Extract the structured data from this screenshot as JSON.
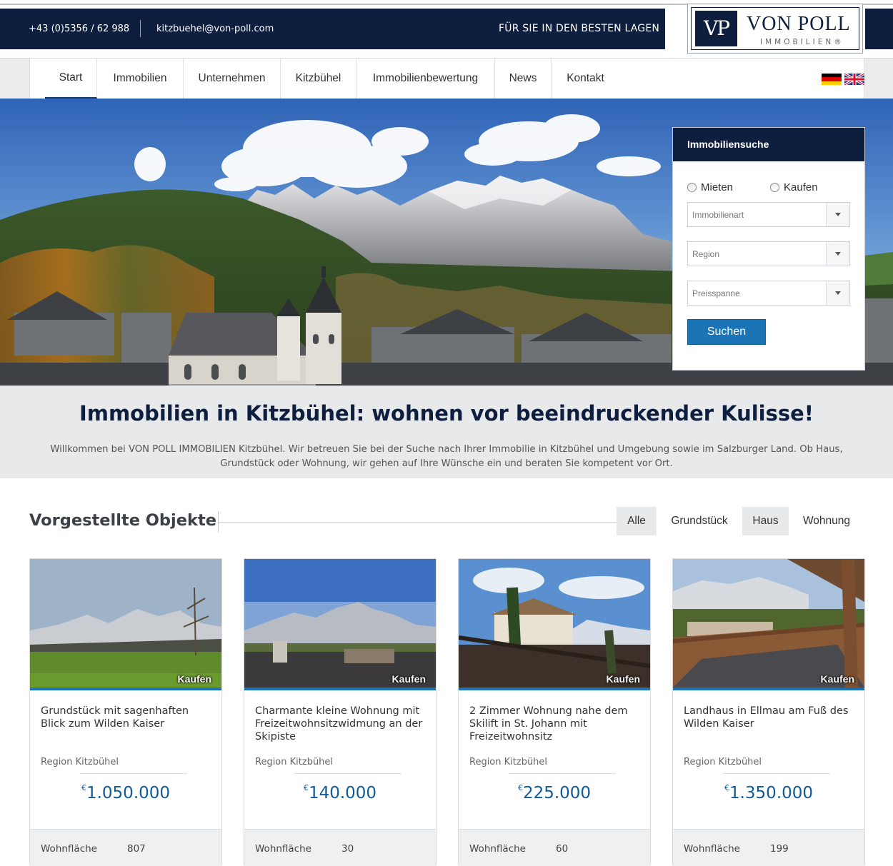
{
  "topbar": {
    "phone": "+43 (0)5356 / 62 988",
    "email": "kitzbuehel@von-poll.com",
    "slogan": "FÜR SIE IN DEN BESTEN LAGEN"
  },
  "logo": {
    "monogram": "VP",
    "name": "VON POLL",
    "sub": "IMMOBILIEN®"
  },
  "nav": {
    "items": [
      {
        "label": "Start"
      },
      {
        "label": "Immobilien"
      },
      {
        "label": "Unternehmen"
      },
      {
        "label": "Kitzbühel"
      },
      {
        "label": "Immobilienbewertung"
      },
      {
        "label": "News"
      },
      {
        "label": "Kontakt"
      }
    ],
    "active": "Start",
    "languages": [
      "de-flag-icon",
      "uk-flag-icon"
    ]
  },
  "search": {
    "title": "Immobiliensuche",
    "radio_rent": "Mieten",
    "radio_buy": "Kaufen",
    "select_type": "Immobilienart",
    "select_region": "Region",
    "select_price": "Preisspanne",
    "button": "Suchen"
  },
  "intro": {
    "heading": "Immobilien in Kitzbühel: wohnen vor beeindruckender Kulisse!",
    "text": "Willkommen bei VON POLL IMMOBILIEN Kitzbühel. Wir betreuen Sie bei der Suche nach Ihrer Immobilie in Kitzbühel und Umgebung sowie im Salzburger Land. Ob Haus, Grundstück oder Wohnung, wir gehen auf Ihre Wünsche ein und beraten Sie kompetent vor Ort."
  },
  "featured": {
    "title": "Vorgestellte Objekte",
    "filters": [
      "Alle",
      "Grundstück",
      "Haus",
      "Wohnung"
    ],
    "cards": [
      {
        "badge": "Kaufen",
        "title": "Grundstück mit sagenhaften Blick zum Wilden Kaiser",
        "region": "Region Kitzbühel",
        "currency": "€",
        "price": "1.050.000",
        "area_label": "Wohnfläche",
        "area_value": "807"
      },
      {
        "badge": "Kaufen",
        "title": "Charmante kleine Wohnung mit Freizeitwohnsitzwidmung an der Skipiste",
        "region": "Region Kitzbühel",
        "currency": "€",
        "price": "140.000",
        "area_label": "Wohnfläche",
        "area_value": "30"
      },
      {
        "badge": "Kaufen",
        "title": "2 Zimmer Wohnung nahe dem Skilift in St. Johann mit Freizeitwohnsitz",
        "region": "Region Kitzbühel",
        "currency": "€",
        "price": "225.000",
        "area_label": "Wohnfläche",
        "area_value": "60"
      },
      {
        "badge": "Kaufen",
        "title": "Landhaus in Ellmau am Fuß des Wilden Kaiser",
        "region": "Region Kitzbühel",
        "currency": "€",
        "price": "1.350.000",
        "area_label": "Wohnfläche",
        "area_value": "199"
      }
    ]
  },
  "colors": {
    "navy": "#0e1e3f",
    "accent_blue": "#1a74b5",
    "price_blue": "#0e5a9a",
    "light_gray": "#e8e9eb"
  }
}
